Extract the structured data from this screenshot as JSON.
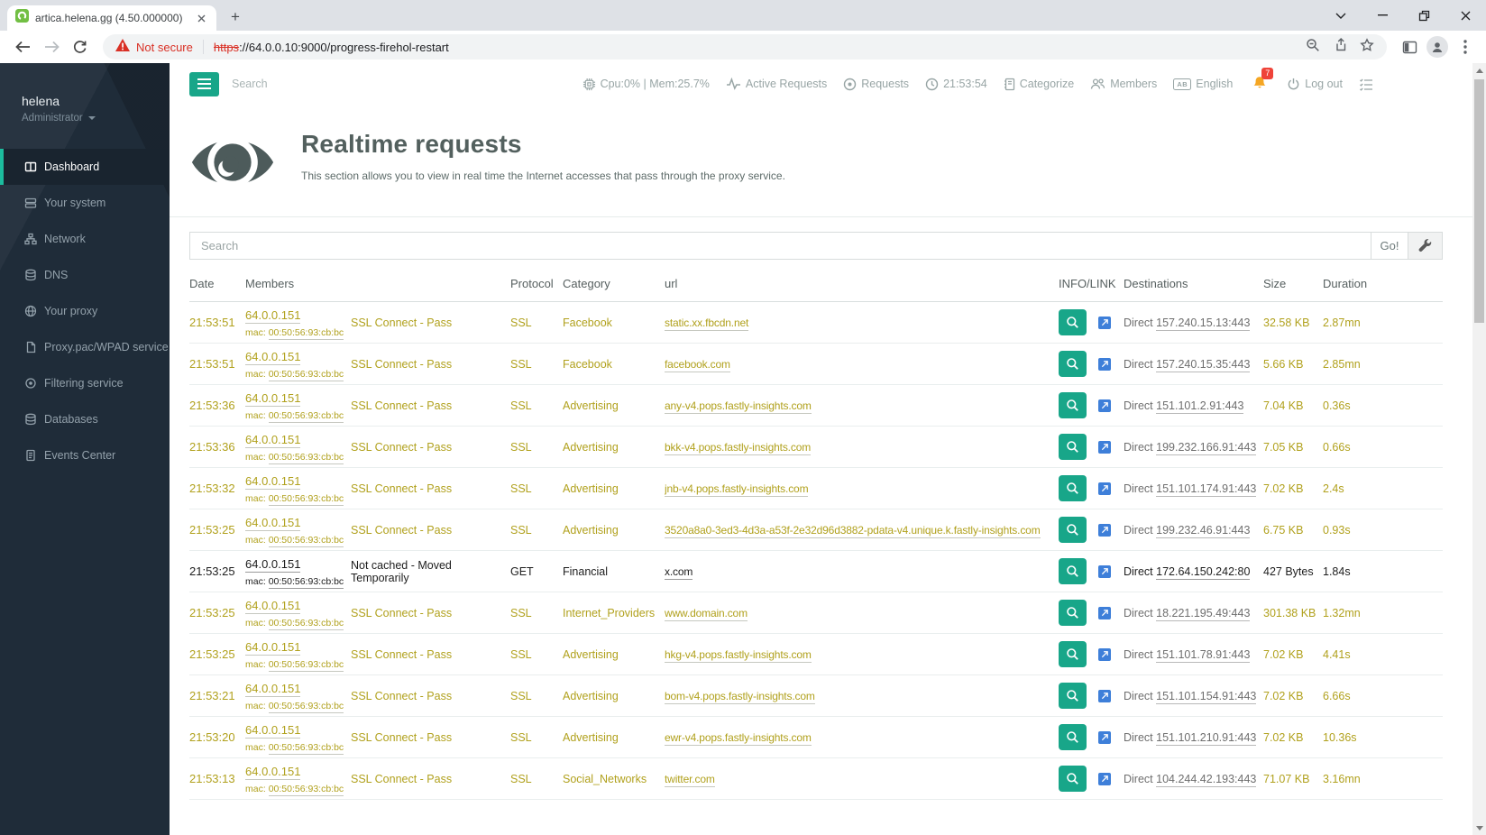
{
  "browser": {
    "tab_title": "artica.helena.gg (4.50.000000)",
    "not_secure_label": "Not secure",
    "url_protocol": "https",
    "url_rest": "://64.0.0.10:9000/progress-firehol-restart"
  },
  "sidebar": {
    "user_name": "helena",
    "user_role": "Administrator",
    "items": [
      {
        "label": "Dashboard",
        "icon": "dashboard-icon",
        "active": true
      },
      {
        "label": "Your system",
        "icon": "server-icon",
        "active": false
      },
      {
        "label": "Network",
        "icon": "network-icon",
        "active": false
      },
      {
        "label": "DNS",
        "icon": "dns-database-icon",
        "active": false
      },
      {
        "label": "Your proxy",
        "icon": "globe-icon",
        "active": false
      },
      {
        "label": "Proxy.pac/WPAD service",
        "icon": "document-icon",
        "active": false
      },
      {
        "label": "Filtering service",
        "icon": "filter-target-icon",
        "active": false
      },
      {
        "label": "Databases",
        "icon": "database-icon",
        "active": false
      },
      {
        "label": "Events Center",
        "icon": "events-file-icon",
        "active": false
      }
    ]
  },
  "topbar": {
    "search_placeholder": "Search",
    "cpu_mem": "Cpu:0% | Mem:25.7%",
    "active_requests_label": "Active Requests",
    "requests_label": "Requests",
    "time": "21:53:54",
    "categorize_label": "Categorize",
    "members_label": "Members",
    "language_label": "English",
    "notifications_count": "7",
    "logout_label": "Log out"
  },
  "page": {
    "title": "Realtime requests",
    "subtitle": "This section allows you to view in real time the Internet accesses that pass through the proxy service."
  },
  "table": {
    "search_placeholder": "Search",
    "go_label": "Go!",
    "mac_prefix": "mac:",
    "direct_label": "Direct",
    "headers": [
      "Date",
      "Members",
      "",
      "Protocol",
      "Category",
      "url",
      "INFO/LINK",
      "Destinations",
      "Size",
      "Duration"
    ],
    "rows": [
      {
        "time": "21:53:51",
        "ip": "64.0.0.151",
        "mac": "00:50:56:93:cb:bc",
        "status": "SSL Connect - Pass",
        "protocol": "SSL",
        "category": "Facebook",
        "url": "static.xx.fbcdn.net",
        "destination": "157.240.15.13:443",
        "size": "32.58 KB",
        "duration": "2.87mn",
        "highlight": false
      },
      {
        "time": "21:53:51",
        "ip": "64.0.0.151",
        "mac": "00:50:56:93:cb:bc",
        "status": "SSL Connect - Pass",
        "protocol": "SSL",
        "category": "Facebook",
        "url": "facebook.com",
        "destination": "157.240.15.35:443",
        "size": "5.66 KB",
        "duration": "2.85mn",
        "highlight": false
      },
      {
        "time": "21:53:36",
        "ip": "64.0.0.151",
        "mac": "00:50:56:93:cb:bc",
        "status": "SSL Connect - Pass",
        "protocol": "SSL",
        "category": "Advertising",
        "url": "any-v4.pops.fastly-insights.com",
        "destination": "151.101.2.91:443",
        "size": "7.04 KB",
        "duration": "0.36s",
        "highlight": false
      },
      {
        "time": "21:53:36",
        "ip": "64.0.0.151",
        "mac": "00:50:56:93:cb:bc",
        "status": "SSL Connect - Pass",
        "protocol": "SSL",
        "category": "Advertising",
        "url": "bkk-v4.pops.fastly-insights.com",
        "destination": "199.232.166.91:443",
        "size": "7.05 KB",
        "duration": "0.66s",
        "highlight": false
      },
      {
        "time": "21:53:32",
        "ip": "64.0.0.151",
        "mac": "00:50:56:93:cb:bc",
        "status": "SSL Connect - Pass",
        "protocol": "SSL",
        "category": "Advertising",
        "url": "jnb-v4.pops.fastly-insights.com",
        "destination": "151.101.174.91:443",
        "size": "7.02 KB",
        "duration": "2.4s",
        "highlight": false
      },
      {
        "time": "21:53:25",
        "ip": "64.0.0.151",
        "mac": "00:50:56:93:cb:bc",
        "status": "SSL Connect - Pass",
        "protocol": "SSL",
        "category": "Advertising",
        "url": "3520a8a0-3ed3-4d3a-a53f-2e32d96d3882-pdata-v4.unique.k.fastly-insights.com",
        "destination": "199.232.46.91:443",
        "size": "6.75 KB",
        "duration": "0.93s",
        "highlight": false
      },
      {
        "time": "21:53:25",
        "ip": "64.0.0.151",
        "mac": "00:50:56:93:cb:bc",
        "status": "Not cached - Moved Temporarily",
        "protocol": "GET",
        "category": "Financial",
        "url": "x.com",
        "destination": "172.64.150.242:80",
        "size": "427 Bytes",
        "duration": "1.84s",
        "highlight": true
      },
      {
        "time": "21:53:25",
        "ip": "64.0.0.151",
        "mac": "00:50:56:93:cb:bc",
        "status": "SSL Connect - Pass",
        "protocol": "SSL",
        "category": "Internet_Providers",
        "url": "www.domain.com",
        "destination": "18.221.195.49:443",
        "size": "301.38 KB",
        "duration": "1.32mn",
        "highlight": false
      },
      {
        "time": "21:53:25",
        "ip": "64.0.0.151",
        "mac": "00:50:56:93:cb:bc",
        "status": "SSL Connect - Pass",
        "protocol": "SSL",
        "category": "Advertising",
        "url": "hkg-v4.pops.fastly-insights.com",
        "destination": "151.101.78.91:443",
        "size": "7.02 KB",
        "duration": "4.41s",
        "highlight": false
      },
      {
        "time": "21:53:21",
        "ip": "64.0.0.151",
        "mac": "00:50:56:93:cb:bc",
        "status": "SSL Connect - Pass",
        "protocol": "SSL",
        "category": "Advertising",
        "url": "bom-v4.pops.fastly-insights.com",
        "destination": "151.101.154.91:443",
        "size": "7.02 KB",
        "duration": "6.66s",
        "highlight": false
      },
      {
        "time": "21:53:20",
        "ip": "64.0.0.151",
        "mac": "00:50:56:93:cb:bc",
        "status": "SSL Connect - Pass",
        "protocol": "SSL",
        "category": "Advertising",
        "url": "ewr-v4.pops.fastly-insights.com",
        "destination": "151.101.210.91:443",
        "size": "7.02 KB",
        "duration": "10.36s",
        "highlight": false
      },
      {
        "time": "21:53:13",
        "ip": "64.0.0.151",
        "mac": "00:50:56:93:cb:bc",
        "status": "SSL Connect - Pass",
        "protocol": "SSL",
        "category": "Social_Networks",
        "url": "twitter.com",
        "destination": "104.244.42.193:443",
        "size": "71.07 KB",
        "duration": "3.16mn",
        "highlight": false
      }
    ]
  },
  "colors": {
    "accent_green": "#18a689",
    "row_text_olive": "#b1a11d",
    "external_link_blue": "#3e7fd9",
    "bell_orange": "#f5a623",
    "badge_red": "#ef4339",
    "not_secure_red": "#d93025",
    "sidebar_bg": "#1f2c39"
  }
}
